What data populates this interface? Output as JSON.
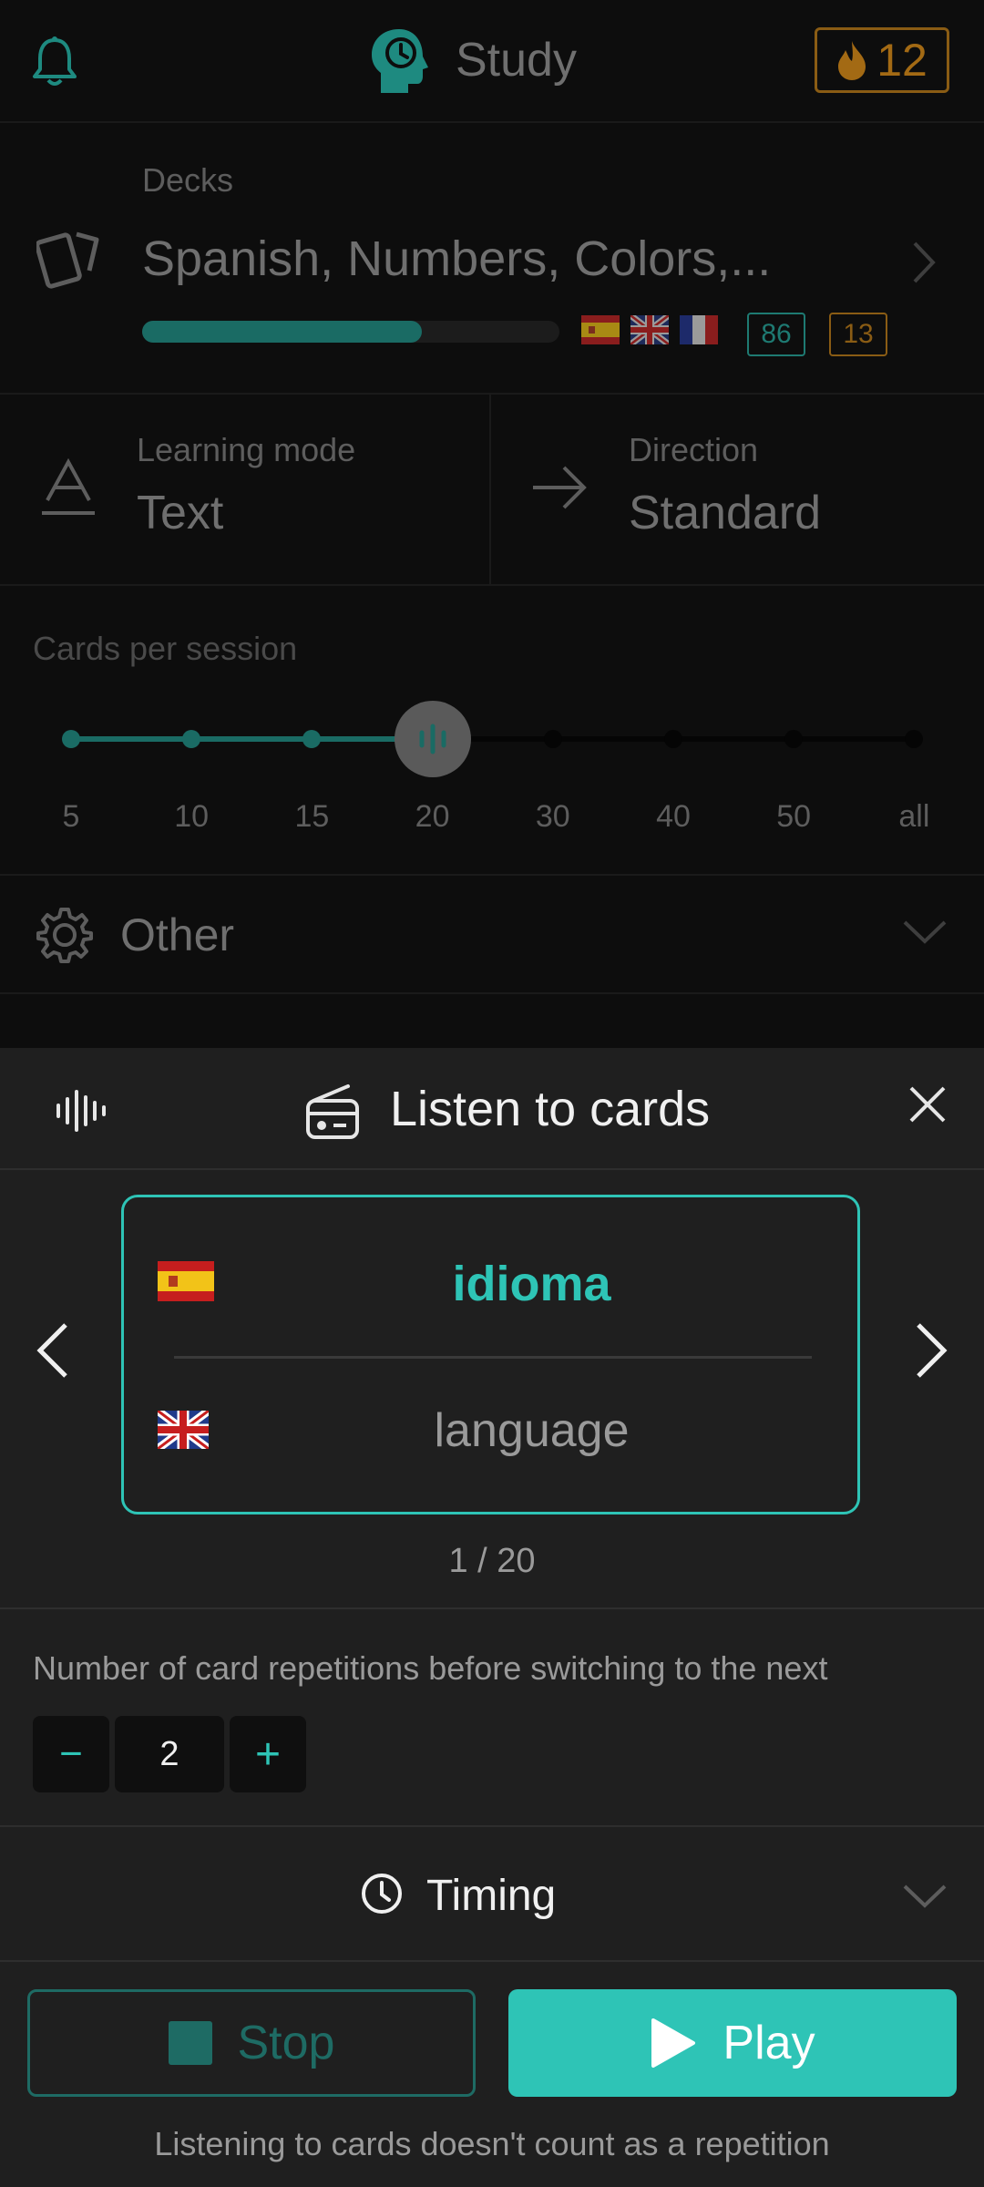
{
  "header": {
    "title": "Study",
    "streak": "12",
    "accent": "#2ec4b6",
    "streak_color": "#c98518"
  },
  "decks": {
    "label": "Decks",
    "value": "Spanish, Numbers, Colors,...",
    "progress": 0.67,
    "flags": [
      "es-flag",
      "uk-flag",
      "fr-flag"
    ],
    "badge_learned": "86",
    "badge_due": "13"
  },
  "learning_mode": {
    "label": "Learning mode",
    "value": "Text"
  },
  "direction": {
    "label": "Direction",
    "value": "Standard"
  },
  "cards_per_session": {
    "label": "Cards per session",
    "ticks": [
      "5",
      "10",
      "15",
      "20",
      "30",
      "40",
      "50",
      "all"
    ],
    "selected": "20"
  },
  "other": {
    "label": "Other"
  },
  "sheet": {
    "title": "Listen to cards",
    "card": {
      "front_word": "idioma",
      "back_word": "language",
      "front_flag": "es-flag",
      "back_flag": "uk-flag"
    },
    "pager": "1 / 20",
    "repetitions": {
      "label": "Number of card repetitions before switching to the next",
      "value": "2",
      "minus": "−",
      "plus": "+"
    },
    "timing": {
      "label": "Timing"
    },
    "stop_label": "Stop",
    "play_label": "Play",
    "footer_note": "Listening to cards doesn't count as a repetition"
  }
}
